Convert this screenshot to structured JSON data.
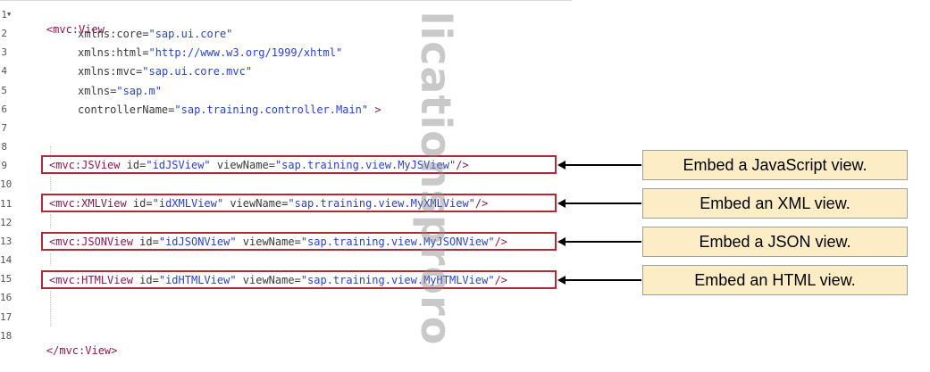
{
  "editor": {
    "line_numbers": [
      "1",
      "2",
      "3",
      "4",
      "5",
      "6",
      "7",
      "8",
      "9",
      "10",
      "11",
      "12",
      "13",
      "14",
      "15",
      "16",
      "17",
      "18"
    ],
    "line1": {
      "open": "<mvc:View"
    },
    "line2": {
      "attr": "xmlns:core",
      "eq": "=",
      "val": "\"sap.ui.core\""
    },
    "line3": {
      "attr": "xmlns:html",
      "eq": "=",
      "val": "\"http://www.w3.org/1999/xhtml\""
    },
    "line4": {
      "attr": "xmlns:mvc",
      "eq": "=",
      "val": "\"sap.ui.core.mvc\""
    },
    "line5": {
      "attr": "xmlns",
      "eq": "=",
      "val": "\"sap.m\""
    },
    "line6": {
      "attr": "controllerName",
      "eq": "=",
      "val": "\"sap.training.controller.Main\"",
      "close": " >"
    },
    "line9": {
      "tag": "<mvc:JSView",
      "a1": " id",
      "eq1": "=",
      "v1": "\"idJSView\"",
      "a2": " viewName",
      "eq2": "=",
      "v2": "\"sap.training.view.MyJSView\"",
      "close": "/>"
    },
    "line11": {
      "tag": "<mvc:XMLView",
      "a1": " id",
      "eq1": "=",
      "v1": "\"idXMLView\"",
      "a2": " viewName",
      "eq2": "=",
      "v2": "\"sap.training.view.MyXMLView\"",
      "close": "/>"
    },
    "line13": {
      "tag": "<mvc:JSONView",
      "a1": " id",
      "eq1": "=",
      "v1": "\"idJSONView\"",
      "a2": " viewName",
      "eq2": "=",
      "v2": "\"sap.training.view.MyJSONView\"",
      "close": "/>"
    },
    "line15": {
      "tag": "<mvc:HTMLView",
      "a1": " id",
      "eq1": "=",
      "v1": "\"idHTMLView\"",
      "a2": " viewName",
      "eq2": "=",
      "v2": "\"sap.training.view.MyHTMLView\"",
      "close": "/>"
    },
    "line18": {
      "close": "</mvc:View>"
    }
  },
  "callouts": [
    "Embed a JavaScript view.",
    "Embed an XML view.",
    "Embed a JSON view.",
    "Embed an HTML view."
  ],
  "watermark": "licationsproro",
  "colors": {
    "tag": "#8b1a52",
    "value": "#2a44c8",
    "highlight_border": "#b22a36",
    "callout_fill": "#fdedc4"
  }
}
